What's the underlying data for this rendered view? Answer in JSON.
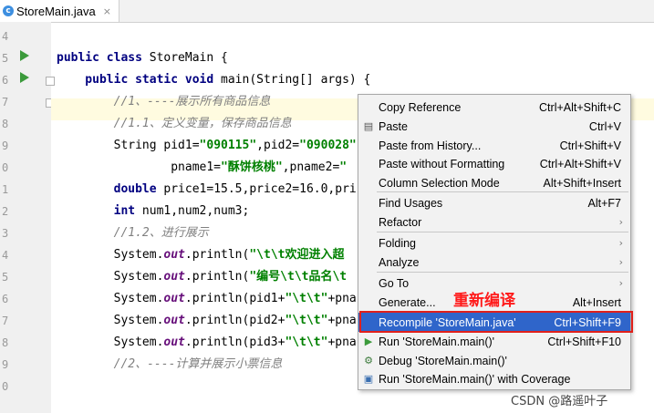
{
  "tab": {
    "title": "StoreMain.java",
    "close": "×"
  },
  "gutter": {
    "lines": [
      "4",
      "5",
      "6",
      "7",
      "8",
      "9",
      "0",
      "1",
      "2",
      "3",
      "4",
      "5",
      "6",
      "7",
      "8",
      "9",
      "0"
    ]
  },
  "code": [
    [],
    [
      {
        "t": "public class ",
        "c": "kw"
      },
      {
        "t": "StoreMain {",
        "c": ""
      }
    ],
    [
      {
        "t": "    public static void ",
        "c": "kw"
      },
      {
        "t": "main(String[] args) {",
        "c": ""
      }
    ],
    [
      {
        "t": "        //1、----展示所有商品信息",
        "c": "cm"
      }
    ],
    [
      {
        "t": "        //1.1、定义变量，保存商品信息",
        "c": "cm"
      }
    ],
    [
      {
        "t": "        String pid1=",
        "c": ""
      },
      {
        "t": "\"090115\"",
        "c": "str"
      },
      {
        "t": ",pid2=",
        "c": ""
      },
      {
        "t": "\"090028\"",
        "c": "str"
      }
    ],
    [
      {
        "t": "                pname1=",
        "c": ""
      },
      {
        "t": "\"酥饼核桃\"",
        "c": "str"
      },
      {
        "t": ",pname2=",
        "c": ""
      },
      {
        "t": "\"",
        "c": "str"
      }
    ],
    [
      {
        "t": "        double ",
        "c": "kw"
      },
      {
        "t": "price1=15.5,price2=16.0,pri",
        "c": ""
      }
    ],
    [
      {
        "t": "        int ",
        "c": "kw"
      },
      {
        "t": "num1,num2,num3;",
        "c": ""
      }
    ],
    [
      {
        "t": "        //1.2、进行展示",
        "c": "cm"
      }
    ],
    [
      {
        "t": "        System.",
        "c": ""
      },
      {
        "t": "out",
        "c": "fld"
      },
      {
        "t": ".println(",
        "c": ""
      },
      {
        "t": "\"\\t\\t欢迎进入超",
        "c": "str"
      }
    ],
    [
      {
        "t": "        System.",
        "c": ""
      },
      {
        "t": "out",
        "c": "fld"
      },
      {
        "t": ".println(",
        "c": ""
      },
      {
        "t": "\"编号\\t\\t品名\\t",
        "c": "str"
      }
    ],
    [
      {
        "t": "        System.",
        "c": ""
      },
      {
        "t": "out",
        "c": "fld"
      },
      {
        "t": ".println(pid1+",
        "c": ""
      },
      {
        "t": "\"\\t\\t\"",
        "c": "str"
      },
      {
        "t": "+pna",
        "c": ""
      }
    ],
    [
      {
        "t": "        System.",
        "c": ""
      },
      {
        "t": "out",
        "c": "fld"
      },
      {
        "t": ".println(pid2+",
        "c": ""
      },
      {
        "t": "\"\\t\\t\"",
        "c": "str"
      },
      {
        "t": "+pna",
        "c": ""
      }
    ],
    [
      {
        "t": "        System.",
        "c": ""
      },
      {
        "t": "out",
        "c": "fld"
      },
      {
        "t": ".println(pid3+",
        "c": ""
      },
      {
        "t": "\"\\t\\t\"",
        "c": "str"
      },
      {
        "t": "+pna",
        "c": ""
      }
    ],
    [
      {
        "t": "        //2、----计算并展示小票信息",
        "c": "cm"
      }
    ],
    []
  ],
  "menu": {
    "items": [
      {
        "label": "Copy Reference",
        "shortcut": "Ctrl+Alt+Shift+C",
        "icon": "",
        "arrow": false
      },
      {
        "label": "Paste",
        "shortcut": "Ctrl+V",
        "icon": "clipboard-icon",
        "arrow": false
      },
      {
        "label": "Paste from History...",
        "shortcut": "Ctrl+Shift+V",
        "icon": "",
        "arrow": false
      },
      {
        "label": "Paste without Formatting",
        "shortcut": "Ctrl+Alt+Shift+V",
        "icon": "",
        "arrow": false
      },
      {
        "label": "Column Selection Mode",
        "shortcut": "Alt+Shift+Insert",
        "icon": "",
        "arrow": false
      },
      {
        "label": "Find Usages",
        "shortcut": "Alt+F7",
        "icon": "",
        "arrow": false
      },
      {
        "label": "Refactor",
        "shortcut": "",
        "icon": "",
        "arrow": true
      },
      {
        "label": "Folding",
        "shortcut": "",
        "icon": "",
        "arrow": true
      },
      {
        "label": "Analyze",
        "shortcut": "",
        "icon": "",
        "arrow": true
      },
      {
        "label": "Go To",
        "shortcut": "",
        "icon": "",
        "arrow": true
      },
      {
        "label": "Generate...",
        "shortcut": "Alt+Insert",
        "icon": "",
        "arrow": false
      },
      {
        "label": "Recompile 'StoreMain.java'",
        "shortcut": "Ctrl+Shift+F9",
        "icon": "",
        "arrow": false
      },
      {
        "label": "Run 'StoreMain.main()'",
        "shortcut": "Ctrl+Shift+F10",
        "icon": "run-icon",
        "arrow": false
      },
      {
        "label": "Debug 'StoreMain.main()'",
        "shortcut": "",
        "icon": "debug-icon",
        "arrow": false
      },
      {
        "label": "Run 'StoreMain.main()' with Coverage",
        "shortcut": "",
        "icon": "coverage-icon",
        "arrow": false
      }
    ],
    "arrow_glyph": "›"
  },
  "annotation": {
    "text": "重新编译",
    "color": "#e0201b"
  },
  "watermark": "CSDN @路遥叶子",
  "colors": {
    "selection": "#2f65ca",
    "run_arrow": "#3b9a3b",
    "keyword": "#000080",
    "string": "#008000"
  }
}
